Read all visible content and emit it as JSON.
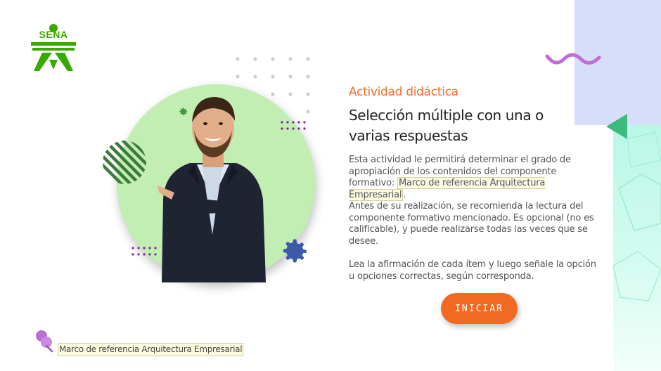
{
  "logo": {
    "text": "SENA",
    "color": "#39a900"
  },
  "activity": {
    "eyebrow": "Actividad didáctica",
    "title": "Selección múltiple con una o varias respuestas",
    "intro_text": "Esta actividad le permitirá determinar el grado de apropiación de los contenidos del componente formativo: ",
    "intro_link": "Marco de referencia Arquitectura  Empresarial",
    "intro_end": ".",
    "paragraph_2": "Antes de su realización, se recomienda la lectura del componente formativo mencionado.  Es opcional (no es calificable), y puede realizarse todas las veces que se desee.",
    "paragraph_3": "Lea la afirmación de cada ítem y luego señale la opción u opciones correctas, según corresponda."
  },
  "button": {
    "label": "INICIAR",
    "color": "#f26a21"
  },
  "footer": {
    "link": "Marco de referencia Arquitectura  Empresarial"
  },
  "icons": {
    "logo": "sena-logo-icon",
    "wave": "wave-icon",
    "triangle": "triangle-icon",
    "gear_small": "gear-icon",
    "gear_large": "gear-icon",
    "stripes": "striped-circle-icon",
    "pin": "pushpin-icon"
  },
  "colors": {
    "accent": "#ef6c2b",
    "title": "#222222",
    "circle": "#c2eeb3",
    "panel_blue": "#d7defa",
    "panel_mint": "#b9f7e6",
    "purple": "#b86fd1"
  }
}
